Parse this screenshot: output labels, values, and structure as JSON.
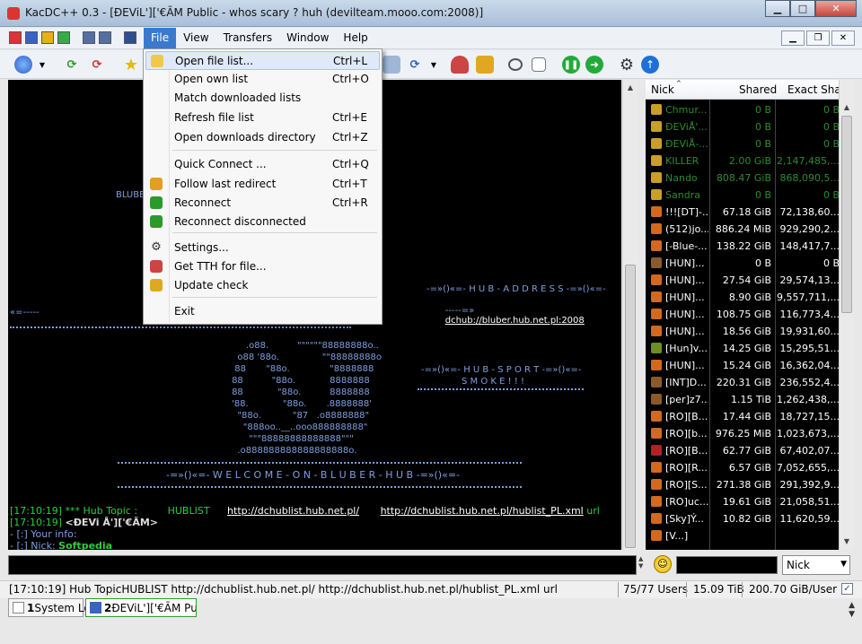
{
  "window": {
    "title": "KacDC++ 0.3 - [ĐEViL']['€ÃM Public -  whos scary ? huh (devilteam.mooo.com:2008)]",
    "min": "▁",
    "max": "□",
    "close": "✕"
  },
  "menubar": {
    "items": [
      "File",
      "View",
      "Transfers",
      "Window",
      "Help"
    ],
    "active": "File",
    "mdi_min": "▁",
    "mdi_restore": "❐",
    "mdi_close": "✕"
  },
  "file_menu": {
    "items": [
      {
        "label": "Open file list...",
        "shortcut": "Ctrl+L",
        "icon": "folder-open-icon"
      },
      {
        "label": "Open own list",
        "shortcut": "Ctrl+O",
        "icon": ""
      },
      {
        "label": "Match downloaded lists",
        "shortcut": "",
        "icon": ""
      },
      {
        "label": "Refresh file list",
        "shortcut": "Ctrl+E",
        "icon": ""
      },
      {
        "label": "Open downloads directory",
        "shortcut": "Ctrl+Z",
        "icon": ""
      },
      {
        "label": "Quick Connect ...",
        "shortcut": "Ctrl+Q",
        "icon": ""
      },
      {
        "label": "Follow last redirect",
        "shortcut": "Ctrl+T",
        "icon": "redirect-icon"
      },
      {
        "label": "Reconnect",
        "shortcut": "Ctrl+R",
        "icon": "reconnect-icon"
      },
      {
        "label": "Reconnect disconnected",
        "shortcut": "",
        "icon": "reconnect-disconnected-icon"
      },
      {
        "label": "Settings...",
        "shortcut": "",
        "icon": "settings-icon"
      },
      {
        "label": "Get TTH for file...",
        "shortcut": "",
        "icon": "tth-icon"
      },
      {
        "label": "Update check",
        "shortcut": "",
        "icon": "update-icon"
      },
      {
        "label": "Exit",
        "shortcut": "",
        "icon": ""
      }
    ]
  },
  "chat": {
    "ascii": {
      "line_left": "«=-----",
      "hub_address_title": "-=»()«=- H U B - A D D R E S S -=»()«=-",
      "hub_address_prefix": "-----=»",
      "hub_address_link": "dchub://bluber.hub.net.pl:2008",
      "hub_sport_1": "-=»()«=- H U B - S P O R T -=»()«=-",
      "hub_sport_2": "S M O K E ! ! !",
      "welcome": "-=»()«=- W E L C O M E - O N - B L U B E R - H U B -=»()«=-",
      "bluber_fragment": "BLUBE",
      "logo": "           .o88.          \"\"\"\"\"\"88888888o..\n        o88 '88o.               \"\"88888888o\n       88       \"88o.              \"8888888\n      88          \"88o.            8888888\n      88            \"88o.          8888888\n      '88.            \"88o.       .8888888'\n        \"88o.           \"87   .o8888888\"\n          \"888oo..__..ooo888888888\"\n            \"\"\"88888888888888\"\"\"\n        .o888888888888888888o."
    },
    "lines": [
      {
        "time": "[17:10:19]",
        "text": "*** Hub Topic :",
        "topic": "HUBLIST",
        "link1": "http://dchublist.hub.net.pl/",
        "link2": "http://dchublist.hub.net.pl/hublist_PL.xml",
        "tail": "url"
      },
      {
        "time": "[17:10:19]",
        "nick": "<ĐEVi Å']['€ÃM>"
      },
      {
        "text": "- [:] Your info:"
      },
      {
        "text": "- [:] Nick:",
        "value": "Softpedia"
      }
    ]
  },
  "userlist": {
    "columns": [
      "Nick",
      "Shared",
      "Exact Share"
    ],
    "rows": [
      {
        "nick": "Chmur...",
        "shared": "0 B",
        "exact": "0 B",
        "color": "#2e8b2e",
        "icon": "#c99f2a"
      },
      {
        "nick": "ĐEViÅ'...",
        "shared": "0 B",
        "exact": "0 B",
        "color": "#2e8b2e",
        "icon": "#c99f2a"
      },
      {
        "nick": "ĐEViÅ-...",
        "shared": "0 B",
        "exact": "0 B",
        "color": "#2e8b2e",
        "icon": "#c99f2a"
      },
      {
        "nick": "KILLER",
        "shared": "2.00 GiB",
        "exact": "2,147,485,...",
        "color": "#2e8b2e",
        "icon": "#c99f2a"
      },
      {
        "nick": "Nando",
        "shared": "808.47 GiB",
        "exact": "868,090,5...",
        "color": "#2e8b2e",
        "icon": "#c99f2a"
      },
      {
        "nick": "Sandra",
        "shared": "0 B",
        "exact": "0 B",
        "color": "#2e8b2e",
        "icon": "#c99f2a"
      },
      {
        "nick": "!!![DT]-...",
        "shared": "67.18 GiB",
        "exact": "72,138,60...",
        "color": "#ffffff",
        "icon": "#d2691e"
      },
      {
        "nick": "(512)jo...",
        "shared": "886.24 MiB",
        "exact": "929,290,2...",
        "color": "#ffffff",
        "icon": "#d2691e"
      },
      {
        "nick": "[-Blue-...",
        "shared": "138.22 GiB",
        "exact": "148,417,7...",
        "color": "#ffffff",
        "icon": "#d2691e"
      },
      {
        "nick": "[HUN]...",
        "shared": "0 B",
        "exact": "0 B",
        "color": "#ffffff",
        "icon": "#8b5a2b"
      },
      {
        "nick": "[HUN]...",
        "shared": "27.54 GiB",
        "exact": "29,574,13...",
        "color": "#ffffff",
        "icon": "#d2691e"
      },
      {
        "nick": "[HUN]...",
        "shared": "8.90 GiB",
        "exact": "9,557,711,...",
        "color": "#ffffff",
        "icon": "#d2691e"
      },
      {
        "nick": "[HUN]...",
        "shared": "108.75 GiB",
        "exact": "116,773,4...",
        "color": "#ffffff",
        "icon": "#d2691e"
      },
      {
        "nick": "[HUN]...",
        "shared": "18.56 GiB",
        "exact": "19,931,60...",
        "color": "#ffffff",
        "icon": "#d2691e"
      },
      {
        "nick": "[Hun]v...",
        "shared": "14.25 GiB",
        "exact": "15,295,51...",
        "color": "#ffffff",
        "icon": "#6b8e23"
      },
      {
        "nick": "[HUN]...",
        "shared": "15.24 GiB",
        "exact": "16,362,04...",
        "color": "#ffffff",
        "icon": "#d2691e"
      },
      {
        "nick": "[INT]D...",
        "shared": "220.31 GiB",
        "exact": "236,552,4...",
        "color": "#ffffff",
        "icon": "#8b5a2b"
      },
      {
        "nick": "[per]z7...",
        "shared": "1.15 TiB",
        "exact": "1,262,438,...",
        "color": "#ffffff",
        "icon": "#8b5a2b"
      },
      {
        "nick": "[RO][B...",
        "shared": "17.44 GiB",
        "exact": "18,727,15...",
        "color": "#ffffff",
        "icon": "#d2691e"
      },
      {
        "nick": "[RO][b...",
        "shared": "976.25 MiB",
        "exact": "1,023,673,...",
        "color": "#ffffff",
        "icon": "#d2691e"
      },
      {
        "nick": "[RO][B...",
        "shared": "62.77 GiB",
        "exact": "67,402,07...",
        "color": "#ffffff",
        "icon": "#b22222"
      },
      {
        "nick": "[RO][R...",
        "shared": "6.57 GiB",
        "exact": "7,052,655,...",
        "color": "#ffffff",
        "icon": "#d2691e"
      },
      {
        "nick": "[RO][S...",
        "shared": "271.38 GiB",
        "exact": "291,392,9...",
        "color": "#ffffff",
        "icon": "#d2691e"
      },
      {
        "nick": "[RO]uc...",
        "shared": "19.61 GiB",
        "exact": "21,058,51...",
        "color": "#ffffff",
        "icon": "#d2691e"
      },
      {
        "nick": "[Sky]Ý...",
        "shared": "10.82 GiB",
        "exact": "11,620,59...",
        "color": "#ffffff",
        "icon": "#d2691e"
      },
      {
        "nick": "[V...]",
        "shared": "",
        "exact": "",
        "color": "#ffffff",
        "icon": "#d2691e"
      }
    ]
  },
  "input": {
    "nick_combo": "Nick",
    "smiley": "☺"
  },
  "status": {
    "message": "[17:10:19] Hub TopicHUBLIST      http://dchublist.hub.net.pl/        http://dchublist.hub.net.pl/hublist_PL.xml  url",
    "users": "75/77 Users",
    "share": "15.09 TiB",
    "per_user": "200.70 GiB/User",
    "check": "✓"
  },
  "tabs": [
    {
      "num": "1",
      "label": "System Log"
    },
    {
      "num": "2",
      "label": "ĐEViL']['€ÃM Publ..."
    }
  ],
  "colors": {
    "accent": "#3b79cf",
    "chat_bg": "#000000",
    "chat_ascii": "#7f9fe0",
    "chat_green": "#2ecc40",
    "op_green": "#2e8b2e"
  }
}
